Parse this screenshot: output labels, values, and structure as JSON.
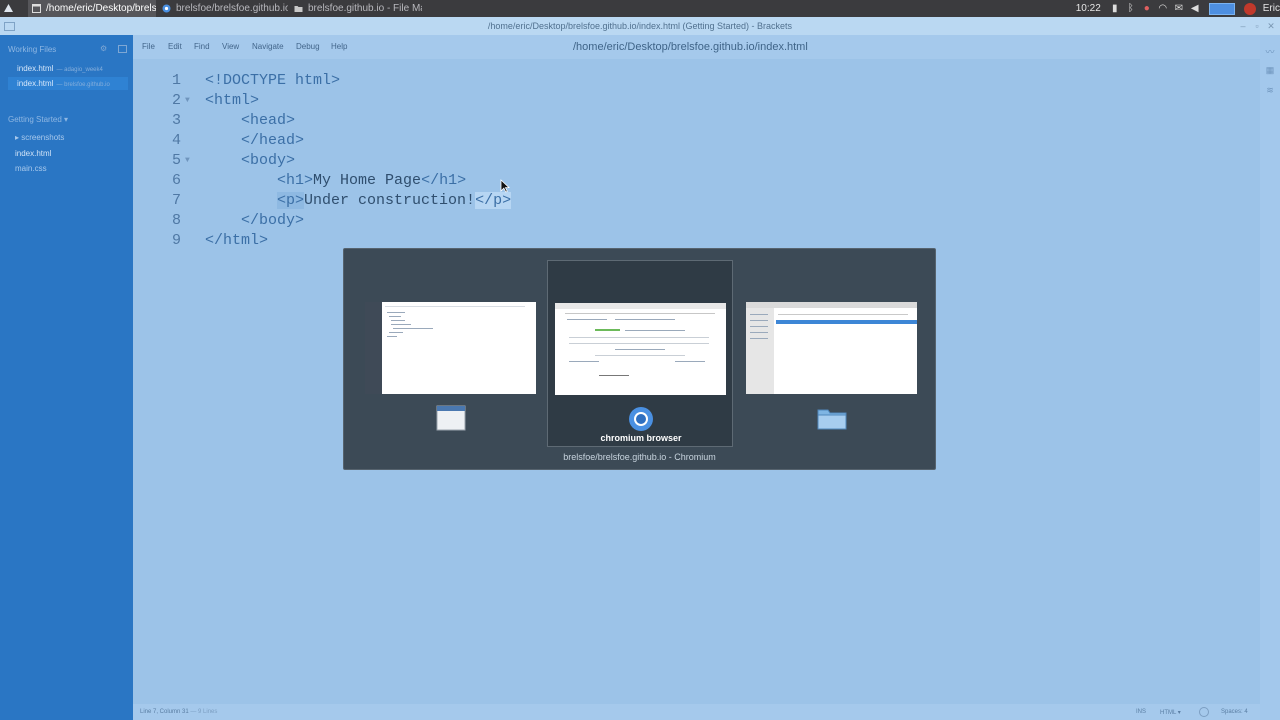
{
  "taskbar": {
    "tasks": [
      {
        "label": "/home/eric/Desktop/brelsf...",
        "icon": "window-icon"
      },
      {
        "label": "brelsfoe/brelsfoe.github.io...",
        "icon": "chromium-icon"
      },
      {
        "label": "brelsfoe.github.io - File Ma...",
        "icon": "folder-icon"
      }
    ],
    "clock": "10:22",
    "user": "Eric"
  },
  "window": {
    "title": "/home/eric/Desktop/brelsfoe.github.io/index.html (Getting Started) - Brackets"
  },
  "sidebar": {
    "working_files_header": "Working Files",
    "working_files": [
      {
        "name": "index.html",
        "sub": "— adagio_week4"
      },
      {
        "name": "index.html",
        "sub": "— brelsfoe.github.io"
      }
    ],
    "project_header": "Getting Started ▾",
    "tree": [
      "▸ screenshots",
      "index.html",
      "main.css"
    ]
  },
  "menu": {
    "items": [
      "File",
      "Edit",
      "Find",
      "View",
      "Navigate",
      "Debug",
      "Help"
    ],
    "filepath": "/home/eric/Desktop/brelsfoe.github.io/index.html"
  },
  "editor": {
    "lines": [
      {
        "num": "1",
        "code": "<!DOCTYPE html>"
      },
      {
        "num": "2",
        "code": "<html>"
      },
      {
        "num": "3",
        "code": "    <head>"
      },
      {
        "num": "4",
        "code": "    </head>"
      },
      {
        "num": "5",
        "code": "    <body>"
      },
      {
        "num": "6",
        "open": "<h1>",
        "text": "My Home Page",
        "close": "</h1>"
      },
      {
        "num": "7",
        "open": "<p>",
        "text": "Under construction!",
        "close": "</p>"
      },
      {
        "num": "8",
        "code": "    </body>"
      },
      {
        "num": "9",
        "code": "</html>"
      }
    ]
  },
  "statusbar": {
    "position": "Line 7, Column 31",
    "lines": "— 9 Lines",
    "mode": "INS",
    "language": "HTML ▾",
    "spaces": "Spaces: 4"
  },
  "switcher": {
    "items": [
      {
        "label": "",
        "icon": "brackets-window-icon"
      },
      {
        "label": "chromium browser",
        "icon": "chromium-icon"
      },
      {
        "label": "",
        "icon": "folder-icon"
      }
    ],
    "selected_index": 1,
    "window_title": "brelsfoe/brelsfoe.github.io - Chromium"
  },
  "colors": {
    "editor_bg": "#9cc3e8",
    "sidebar_bg": "#2a76c4",
    "switcher_bg": "#3c4a56",
    "tag": "#3b6fa6"
  }
}
